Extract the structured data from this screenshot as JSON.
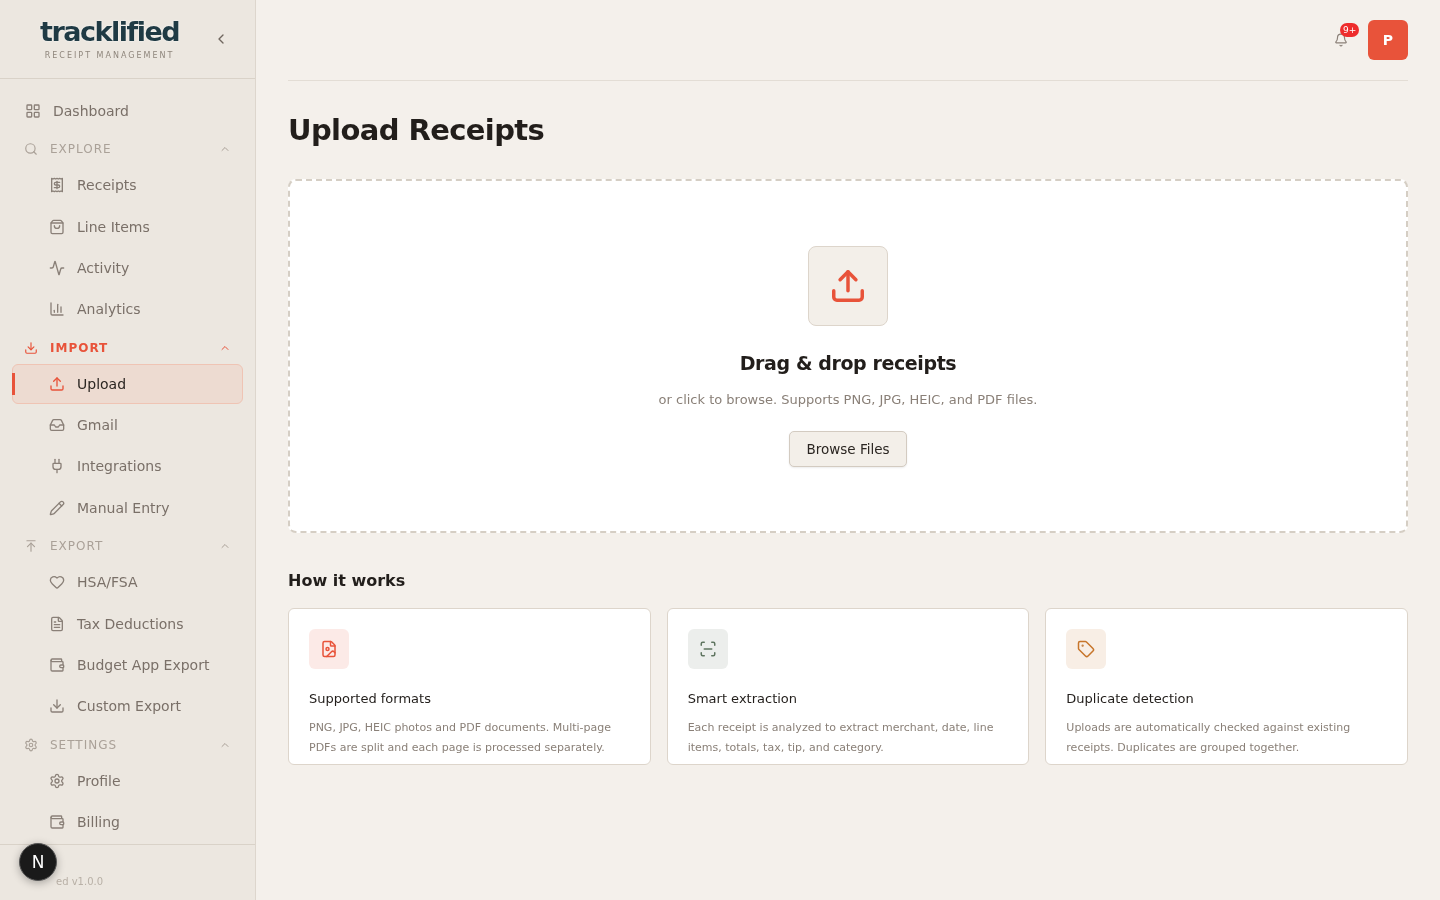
{
  "sidebar": {
    "logo": "tracklified",
    "tagline": "RECEIPT MANAGEMENT",
    "nav": [
      {
        "kind": "link",
        "label": "Dashboard",
        "selected": false
      },
      {
        "kind": "group",
        "label": "EXPLORE",
        "expanded": true,
        "children": [
          {
            "label": "Receipts",
            "selected": false
          },
          {
            "label": "Line Items",
            "selected": false
          },
          {
            "label": "Activity",
            "selected": false
          },
          {
            "label": "Analytics",
            "selected": false
          }
        ]
      },
      {
        "kind": "group",
        "label": "IMPORT",
        "expanded": true,
        "children": [
          {
            "label": "Upload",
            "selected": true
          },
          {
            "label": "Gmail",
            "selected": false
          },
          {
            "label": "Integrations",
            "selected": false
          },
          {
            "label": "Manual Entry",
            "selected": false
          }
        ]
      },
      {
        "kind": "group",
        "label": "EXPORT",
        "expanded": true,
        "children": [
          {
            "label": "HSA/FSA",
            "selected": false
          },
          {
            "label": "Tax Deductions",
            "selected": false
          },
          {
            "label": "Budget App Export",
            "selected": false
          },
          {
            "label": "Custom Export",
            "selected": false
          }
        ]
      },
      {
        "kind": "group",
        "label": "SETTINGS",
        "expanded": true,
        "children": [
          {
            "label": "Profile",
            "selected": false
          },
          {
            "label": "Billing",
            "selected": false
          }
        ]
      }
    ],
    "version": "ed v1.0.0"
  },
  "dev_badge": "N",
  "header": {
    "notifications": "9+",
    "avatar": "P"
  },
  "page": {
    "title": "Upload Receipts",
    "dropzone": {
      "title": "Drag & drop receipts",
      "hint": "or click to browse. Supports PNG, JPG, HEIC, and PDF files.",
      "button": "Browse Files"
    },
    "how_it_works": {
      "title": "How it works",
      "cards": [
        {
          "title": "Supported formats",
          "text": "PNG, JPG, HEIC photos and PDF documents. Multi-page PDFs are split and each page is processed separately.",
          "color": "#e8533a"
        },
        {
          "title": "Smart extraction",
          "text": "Each receipt is analyzed to extract merchant, date, line items, totals, tax, tip, and category.",
          "color": "#5f7560"
        },
        {
          "title": "Duplicate detection",
          "text": "Uploads are automatically checked against existing receipts. Duplicates are grouped together.",
          "color": "#c7752a"
        }
      ]
    }
  }
}
